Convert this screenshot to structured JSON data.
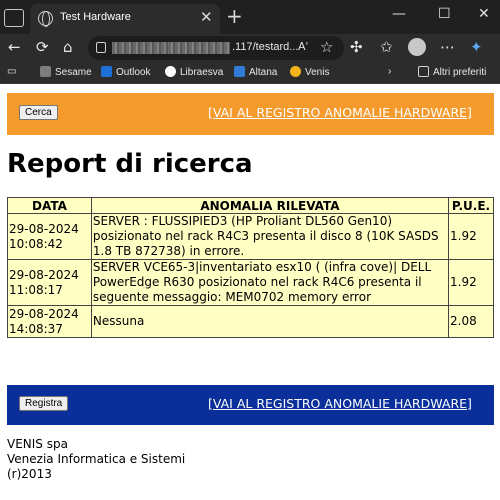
{
  "browser": {
    "tab_title": "Test Hardware",
    "tab_close": "✕",
    "new_tab": "+",
    "window_buttons": [
      "—",
      "☐",
      "✕"
    ],
    "url_visible": ".117/testard...",
    "read_aloud": "Aʾ",
    "bookmarks": [
      {
        "label": "Sesame",
        "icon": "sesame-icon",
        "color": "#7d7d7d"
      },
      {
        "label": "Outlook",
        "icon": "outlook-icon",
        "color": "#1e70d8"
      },
      {
        "label": "Libraesva",
        "icon": "libraesva-icon",
        "color": "#ffffff"
      },
      {
        "label": "Altana",
        "icon": "altana-icon",
        "color": "#2f7bd6"
      },
      {
        "label": "Venis",
        "icon": "venis-icon",
        "color": "#f2b51b"
      }
    ],
    "more_bookmarks": "Altri preferiti"
  },
  "page": {
    "top_bar": {
      "button": "Cerca",
      "link": "[VAI AL REGISTRO ANOMALIE HARDWARE]",
      "color": "#f59b2e"
    },
    "title": "Report di ricerca",
    "table": {
      "headers": [
        "DATA",
        "ANOMALIA RILEVATA",
        "P.U.E."
      ],
      "rows": [
        {
          "date": "29-08-2024 10:08:42",
          "anomaly": "SERVER : FLUSSIPIED3 (HP Proliant DL560 Gen10) posizionato nel rack R4C3 presenta il disco 8 (10K SASDS 1.8 TB 872738) in errore.",
          "pue": "1.92"
        },
        {
          "date": "29-08-2024 11:08:17",
          "anomaly": "SERVER VCE65-3|inventariato esx10 ( (infra cove)| DELL PowerEdge R630 posizionato nel rack R4C6 presenta il seguente messaggio: MEM0702 memory error",
          "pue": "1.92"
        },
        {
          "date": "29-08-2024 14:08:37",
          "anomaly": "Nessuna",
          "pue": "2.08"
        }
      ],
      "cell_color": "#ffffc4"
    },
    "bottom_bar": {
      "button": "Registra",
      "link": "[VAI AL REGISTRO ANOMALIE HARDWARE]",
      "color": "#0a2f9a"
    },
    "footer": [
      "VENIS spa",
      "Venezia Informatica e Sistemi",
      "(r)2013"
    ]
  }
}
